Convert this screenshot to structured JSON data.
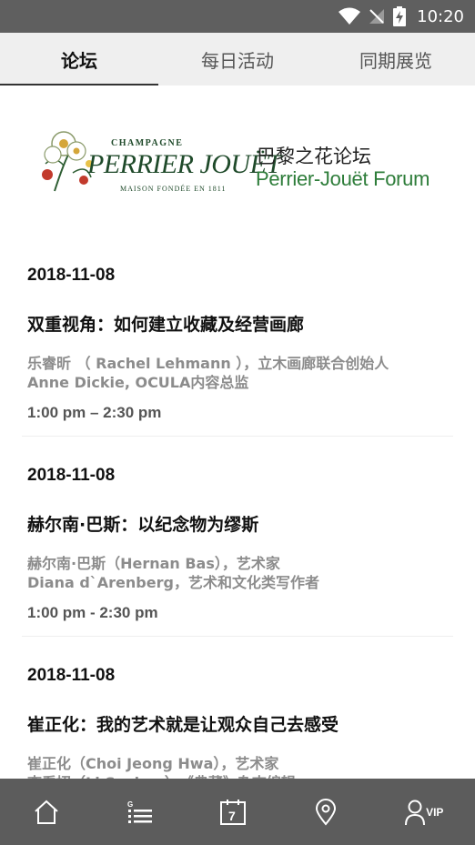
{
  "status_bar": {
    "time": "10:20"
  },
  "tabs": [
    {
      "label": "论坛",
      "active": true
    },
    {
      "label": "每日活动",
      "active": false
    },
    {
      "label": "同期展览",
      "active": false
    }
  ],
  "brand": {
    "champagne": "CHAMPAGNE",
    "name": "PERRIER JOUËT",
    "maison": "MAISON FONDÉE EN 1811",
    "forum_cn": "巴黎之花论坛",
    "forum_en": "Perrier-Jouët Forum",
    "accent_color": "#2e7d3a"
  },
  "events": [
    {
      "date": "2018-11-08",
      "title": "双重视角：如何建立收藏及经营画廊",
      "speaker1": "乐睿昕 （ Rachel Lehmann ），立木画廊联合创始人",
      "speaker2": "Anne Dickie, OCULA内容总监",
      "time": "1:00 pm – 2:30 pm"
    },
    {
      "date": "2018-11-08",
      "title": "赫尔南·巴斯：以纪念物为缪斯",
      "speaker1": "赫尔南·巴斯（Hernan Bas），艺术家",
      "speaker2": "Diana d`Arenberg，艺术和文化类写作者",
      "time": "1:00 pm - 2:30 pm"
    },
    {
      "date": "2018-11-08",
      "title": "崔正化：我的艺术就是让观众自己去感受",
      "speaker1": "崔正化（Choi Jeong Hwa），艺术家",
      "speaker2": "李看招（Li Suchao），《典藏》杂志编辑",
      "time": ""
    }
  ],
  "bottom_nav": {
    "calendar_day": "7",
    "vip_label": "VIP"
  }
}
